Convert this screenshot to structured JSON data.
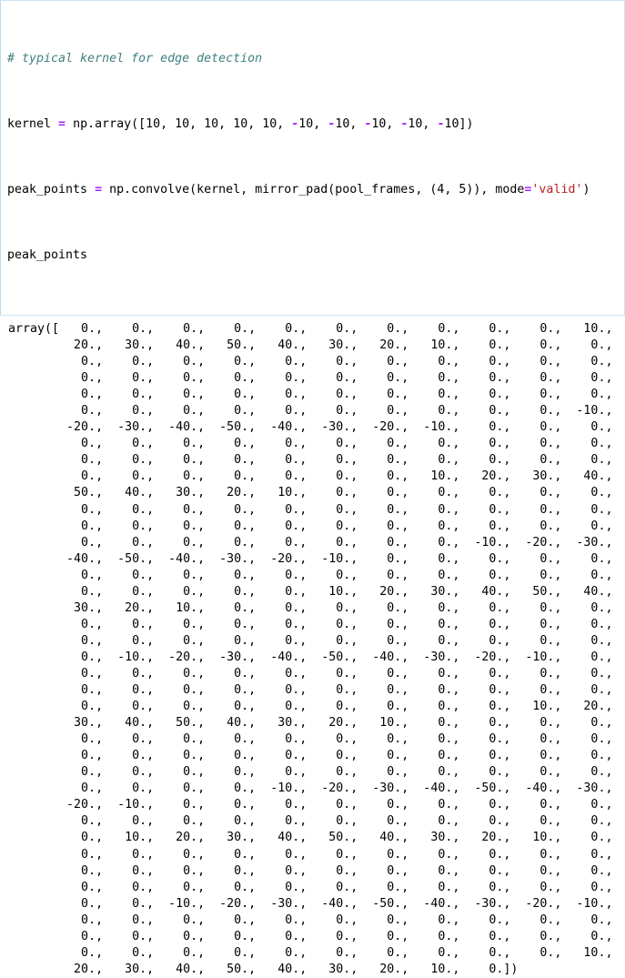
{
  "cell": {
    "type": "code-cell",
    "border_color": "#cfe2f3",
    "background": "#ffffff"
  },
  "code": {
    "comment_text": "# typical kernel for edge detection",
    "line2": {
      "name": "kernel",
      "op": " = ",
      "call": "np.array([10, 10, 10, 10, 10, ",
      "neg1": "-",
      "n1": "10, ",
      "neg2": "-",
      "n2": "10, ",
      "neg3": "-",
      "n3": "10, ",
      "neg4": "-",
      "n4": "10, ",
      "neg5": "-",
      "n5": "10])"
    },
    "line3": {
      "name": "peak_points",
      "op": " = ",
      "call": "np.convolve(kernel, mirror_pad(pool_frames, (4, 5)), mode",
      "eq": "=",
      "string": "'valid'",
      "close": ")"
    },
    "line4": {
      "name": "peak_points"
    },
    "full_text_lines": [
      "# typical kernel for edge detection",
      "kernel = np.array([10, 10, 10, 10, 10, -10, -10, -10, -10, -10])",
      "peak_points = np.convolve(kernel, mirror_pad(pool_frames, (4, 5)), mode='valid')",
      "peak_points"
    ],
    "colors": {
      "comment": "#408080",
      "operator": "#aa22ff",
      "string": "#ba2121",
      "plain": "#000000"
    }
  },
  "output": {
    "prefix": "array([",
    "suffix": "])",
    "values_per_line": 11,
    "number_field_width": 6,
    "separator": ", ",
    "array_values": [
      0,
      0,
      0,
      0,
      0,
      0,
      0,
      0,
      0,
      0,
      10,
      20,
      30,
      40,
      50,
      40,
      30,
      20,
      10,
      0,
      0,
      0,
      0,
      0,
      0,
      0,
      0,
      0,
      0,
      0,
      0,
      0,
      0,
      0,
      0,
      0,
      0,
      0,
      0,
      0,
      0,
      0,
      0,
      0,
      0,
      0,
      0,
      0,
      0,
      0,
      0,
      0,
      0,
      0,
      0,
      0,
      0,
      0,
      0,
      0,
      0,
      0,
      0,
      0,
      0,
      -10,
      -20,
      -30,
      -40,
      -50,
      -40,
      -30,
      -20,
      -10,
      0,
      0,
      0,
      0,
      0,
      0,
      0,
      0,
      0,
      0,
      0,
      0,
      0,
      0,
      0,
      0,
      0,
      0,
      0,
      0,
      0,
      0,
      0,
      0,
      0,
      0,
      0,
      0,
      0,
      0,
      0,
      0,
      10,
      20,
      30,
      40,
      50,
      40,
      30,
      20,
      10,
      0,
      0,
      0,
      0,
      0,
      0,
      0,
      0,
      0,
      0,
      0,
      0,
      0,
      0,
      0,
      0,
      0,
      0,
      0,
      0,
      0,
      0,
      0,
      0,
      0,
      0,
      0,
      0,
      0,
      0,
      0,
      0,
      0,
      0,
      0,
      0,
      -10,
      -20,
      -30,
      -40,
      -50,
      -40,
      -30,
      -20,
      -10,
      0,
      0,
      0,
      0,
      0,
      0,
      0,
      0,
      0,
      0,
      0,
      0,
      0,
      0,
      0,
      0,
      0,
      0,
      0,
      0,
      0,
      10,
      20,
      30,
      40,
      50,
      40,
      30,
      20,
      10,
      0,
      0,
      0,
      0,
      0,
      0,
      0,
      0,
      0,
      0,
      0,
      0,
      0,
      0,
      0,
      0,
      0,
      0,
      0,
      0,
      0,
      0,
      0,
      0,
      0,
      0,
      0,
      0,
      0,
      0,
      0,
      -10,
      -20,
      -30,
      -40,
      -50,
      -40,
      -30,
      -20,
      -10,
      0,
      0,
      0,
      0,
      0,
      0,
      0,
      0,
      0,
      0,
      0,
      0,
      0,
      0,
      0,
      0,
      0,
      0,
      0,
      0,
      0,
      0,
      0,
      0,
      0,
      0,
      0,
      0,
      0,
      0,
      0,
      0,
      10,
      20,
      30,
      40,
      50,
      40,
      30,
      20,
      10,
      0,
      0,
      0,
      0,
      0,
      0,
      0,
      0,
      0,
      0,
      0,
      0,
      0,
      0,
      0,
      0,
      0,
      0,
      0,
      0,
      0,
      0,
      0,
      0,
      0,
      0,
      0,
      0,
      0,
      0,
      0,
      0,
      0,
      0,
      0,
      0,
      0,
      0,
      0,
      0,
      0,
      -10,
      -20,
      -30,
      -40,
      -50,
      -40,
      -30,
      -20,
      -10,
      0,
      0,
      0,
      0,
      0,
      0,
      0,
      0,
      0,
      0,
      0,
      0,
      0,
      0,
      0,
      0,
      0,
      0,
      0,
      0,
      0,
      10,
      20,
      30,
      40,
      50,
      40,
      30,
      20,
      10,
      0,
      0,
      0,
      0,
      0,
      0,
      0,
      0,
      0,
      0,
      0,
      0,
      0,
      0,
      0,
      0,
      0,
      0,
      0,
      0,
      0,
      0,
      0,
      0,
      0,
      0,
      0,
      0,
      0,
      0,
      0,
      0,
      0,
      0,
      0,
      0,
      -10,
      -20,
      -30,
      -40,
      -50,
      -40,
      -30,
      -20,
      -10,
      0,
      0,
      0,
      0,
      0,
      0,
      0,
      0,
      0,
      0,
      0,
      0,
      0,
      0,
      0,
      0,
      0,
      0,
      0,
      0,
      0,
      0,
      0,
      0,
      0,
      0,
      0,
      0,
      0,
      0,
      0,
      0,
      10,
      20,
      30,
      40,
      50,
      40,
      30,
      20,
      10,
      0
    ]
  }
}
